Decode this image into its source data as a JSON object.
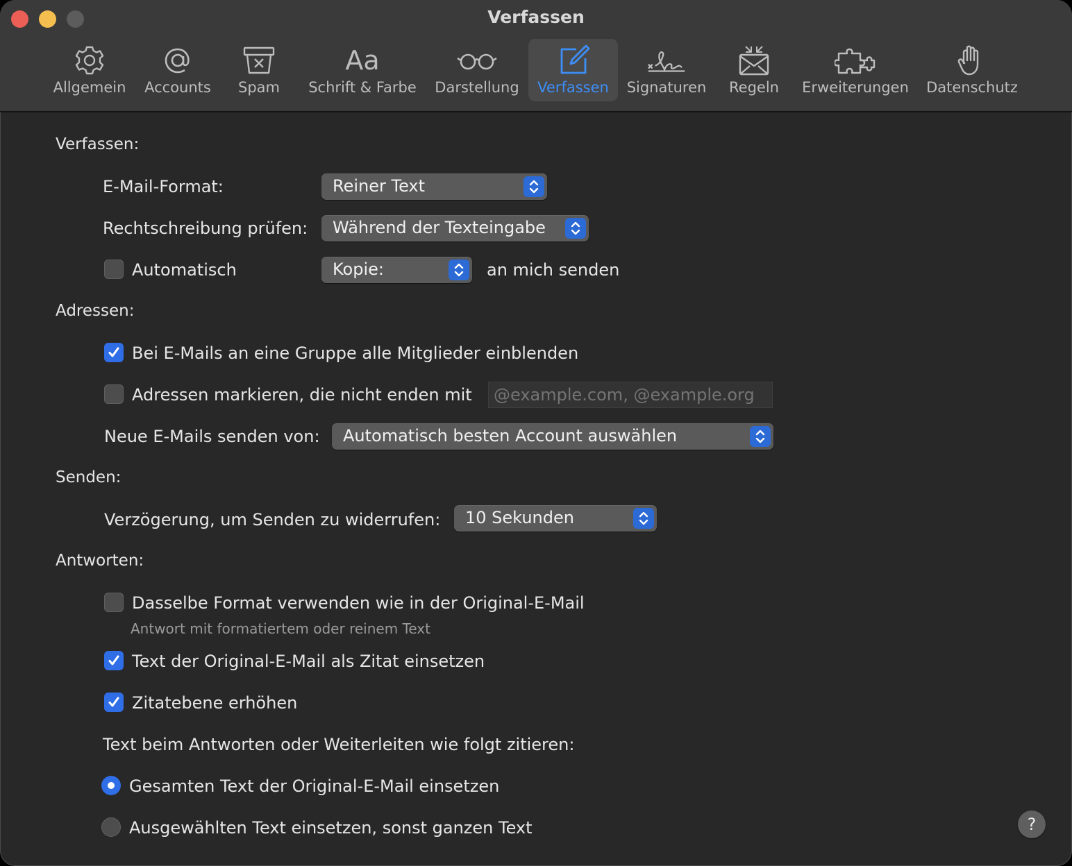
{
  "window": {
    "title": "Verfassen",
    "colors": {
      "accent": "#3e8ef7",
      "window_bg": "#282828",
      "toolbar_bg": "#3a3a3a",
      "checkbox_on": "#2f6ee6"
    }
  },
  "toolbar": {
    "tabs": [
      {
        "label": "Allgemein",
        "icon": "gear-icon",
        "active": false
      },
      {
        "label": "Accounts",
        "icon": "at-sign-icon",
        "active": false
      },
      {
        "label": "Spam",
        "icon": "junk-tray-icon",
        "active": false
      },
      {
        "label": "Schrift & Farbe",
        "icon": "font-icon",
        "active": false
      },
      {
        "label": "Darstellung",
        "icon": "glasses-icon",
        "active": false
      },
      {
        "label": "Verfassen",
        "icon": "compose-icon",
        "active": true
      },
      {
        "label": "Signaturen",
        "icon": "signature-icon",
        "active": false
      },
      {
        "label": "Regeln",
        "icon": "rules-envelope-icon",
        "active": false
      },
      {
        "label": "Erweiterungen",
        "icon": "puzzle-icon",
        "active": false
      },
      {
        "label": "Datenschutz",
        "icon": "hand-icon",
        "active": false
      }
    ],
    "font_glyph": "Aa"
  },
  "compose": {
    "heading": "Verfassen:",
    "format_label": "E-Mail-Format:",
    "format_value": "Reiner Text",
    "spell_label": "Rechtschreibung prüfen:",
    "spell_value": "Während der Texteingabe",
    "auto_label": "Automatisch",
    "auto_checked": false,
    "copy_value": "Kopie:",
    "copy_suffix": "an mich senden"
  },
  "addresses": {
    "heading": "Adressen:",
    "group_label": "Bei E-Mails an eine Gruppe alle Mitglieder einblenden",
    "group_checked": true,
    "mark_label": "Adressen markieren, die nicht enden mit",
    "mark_checked": false,
    "mark_placeholder": "@example.com, @example.org",
    "send_from_label": "Neue E-Mails senden von:",
    "send_from_value": "Automatisch besten Account auswählen"
  },
  "sending": {
    "heading": "Senden:",
    "undo_label": "Verzögerung, um Senden zu widerrufen:",
    "undo_value": "10 Sekunden"
  },
  "replying": {
    "heading": "Antworten:",
    "same_format_label": "Dasselbe Format verwenden wie in der Original-E-Mail",
    "same_format_checked": false,
    "same_format_hint": "Antwort mit formatiertem oder reinem Text",
    "quote_label": "Text der Original-E-Mail als Zitat einsetzen",
    "quote_checked": true,
    "increase_label": "Zitatebene erhöhen",
    "increase_checked": true,
    "quote_mode_label": "Text beim Antworten oder Weiterleiten wie folgt zitieren:",
    "option_all_label": "Gesamten Text der Original-E-Mail einsetzen",
    "option_selected_label": "Ausgewählten Text einsetzen, sonst ganzen Text",
    "selected_option": "all"
  },
  "help": {
    "label": "?"
  }
}
